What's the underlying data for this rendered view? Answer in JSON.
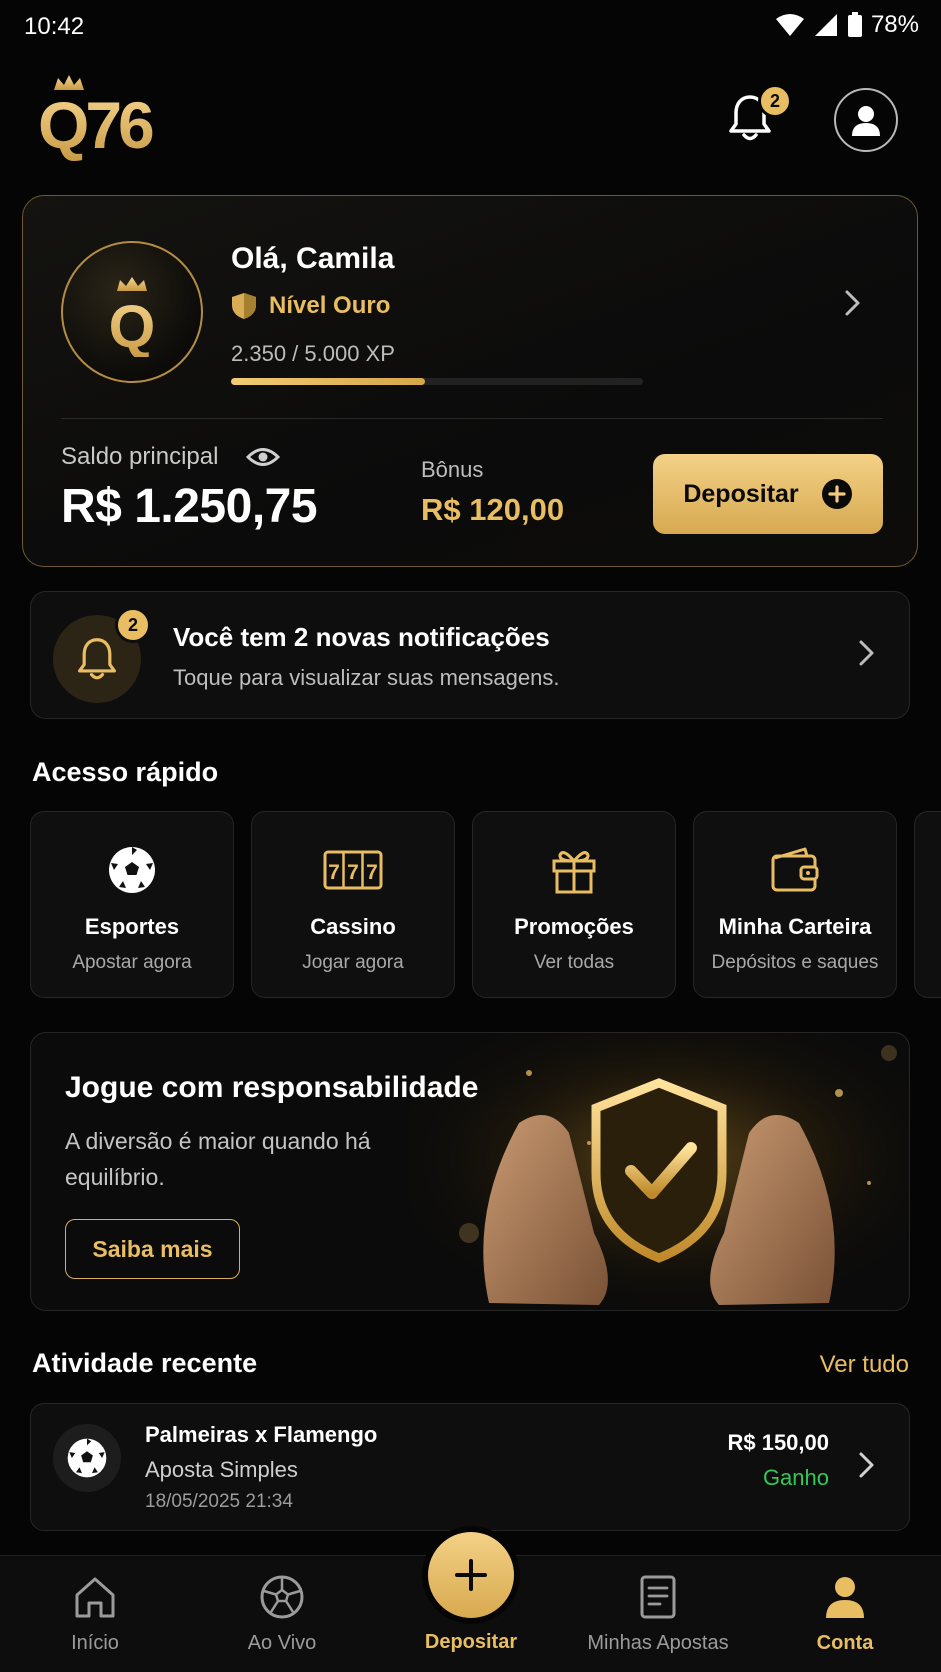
{
  "status_bar": {
    "time": "10:42",
    "battery": "78%"
  },
  "header": {
    "logo_text": "Q76",
    "notification_count": "2"
  },
  "profile": {
    "greeting": "Olá, Camila",
    "level": "Nível Ouro",
    "xp_text": "2.350 / 5.000 XP",
    "xp_progress": 0.47,
    "balance_label": "Saldo principal",
    "balance_value": "R$ 1.250,75",
    "bonus_label": "Bônus",
    "bonus_value": "R$ 120,00",
    "deposit_label": "Depositar"
  },
  "notification": {
    "count": "2",
    "title": "Você tem 2 novas notificações",
    "subtitle": "Toque para visualizar suas mensagens."
  },
  "quick_access": {
    "title": "Acesso rápido",
    "items": [
      {
        "label": "Esportes",
        "sub": "Apostar agora",
        "icon": "soccer-ball-icon"
      },
      {
        "label": "Cassino",
        "sub": "Jogar agora",
        "icon": "slot-machine-icon"
      },
      {
        "label": "Promoções",
        "sub": "Ver todas",
        "icon": "gift-icon"
      },
      {
        "label": "Minha Carteira",
        "sub": "Depósitos e saques",
        "icon": "wallet-icon"
      }
    ]
  },
  "banner": {
    "title": "Jogue com responsabilidade",
    "text": "A diversão é maior quando há equilíbrio.",
    "button": "Saiba mais"
  },
  "activity": {
    "title": "Atividade recente",
    "see_all": "Ver tudo",
    "items": [
      {
        "match": "Palmeiras x Flamengo",
        "type": "Aposta Simples",
        "date": "18/05/2025 21:34",
        "amount": "R$ 150,00",
        "status": "Ganho"
      }
    ]
  },
  "nav": {
    "items": [
      {
        "label": "Início",
        "icon": "home-icon"
      },
      {
        "label": "Ao Vivo",
        "icon": "soccer-ball-icon"
      },
      {
        "label": "Depositar",
        "icon": "plus-icon"
      },
      {
        "label": "Minhas Apostas",
        "icon": "bet-slip-icon"
      },
      {
        "label": "Conta",
        "icon": "user-icon"
      }
    ],
    "active": "Conta"
  },
  "colors": {
    "accent": "#e9bd62",
    "background": "#050505",
    "success": "#34c759"
  }
}
